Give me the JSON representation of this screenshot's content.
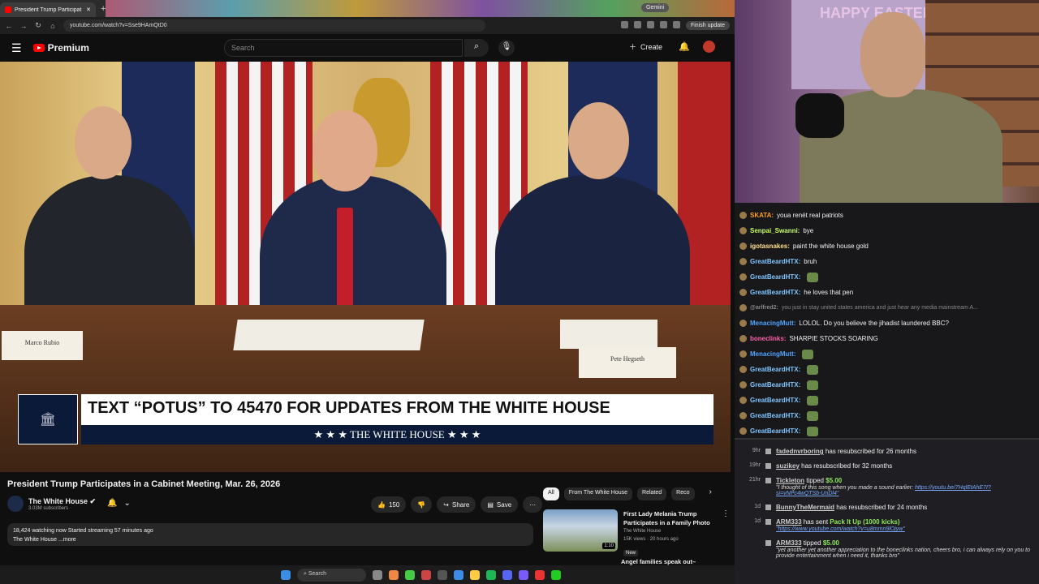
{
  "browser": {
    "tab_title": "President Trump Participat",
    "new_tab": "+",
    "gemini_label": "Gemini",
    "url": "youtube.com/watch?v=Sse9HAmQtD0",
    "finish_update": "Finish update"
  },
  "youtube": {
    "logo": "Premium",
    "search_placeholder": "Search",
    "create_label": "Create"
  },
  "video": {
    "banner_text": "TEXT “POTUS” TO 45470 FOR UPDATES FROM THE WHITE HOUSE",
    "banner_sub": "★ ★ ★  THE WHITE HOUSE  ★ ★ ★",
    "namecard_left": "Marco Rubio",
    "namecard_right": "Pete Hegseth",
    "title": "President Trump Participates in a Cabinet Meeting, Mar. 26, 2026",
    "channel": "The White House",
    "subscribers": "3.03M subscribers",
    "likes": "150",
    "share": "Share",
    "save": "Save",
    "watching": "18,424 watching now  Started streaming 57 minutes ago",
    "desc_more": "The White House ...more"
  },
  "chips": [
    "All",
    "From The White House",
    "Related",
    "Reco"
  ],
  "recommendation": {
    "title": "First Lady Melania Trump Participates in a Family Photo",
    "channel": "The White House",
    "meta": "15K views · 20 hours ago",
    "badge": "New",
    "duration": "1:10",
    "next_title": "Angel families speak out–"
  },
  "taskbar": {
    "search": "Search"
  },
  "webcam": {
    "sign": "HAPPY EASTER"
  },
  "chat": [
    {
      "user": "SKATA:",
      "text": "youa renét real patriots",
      "color": "#ff9f1a"
    },
    {
      "user": "Senpai_Swanni:",
      "text": "bye",
      "color": "#c6ff5e"
    },
    {
      "user": "igotasnakes:",
      "text": "paint the white house gold",
      "color": "#ffe08a"
    },
    {
      "user": "GreatBeardHTX:",
      "text": "bruh",
      "color": "#7fc6ff"
    },
    {
      "user": "GreatBeardHTX:",
      "text": "",
      "color": "#7fc6ff"
    },
    {
      "user": "GreatBeardHTX:",
      "text": "he loves that pen",
      "color": "#7fc6ff"
    },
    {
      "user": "@arlfred2:",
      "text": "you just in stay united states america and just hear any media mainstream A...",
      "color": "#888"
    },
    {
      "user": "MenacingMutt:",
      "text": "LOLOL. Do you believe the jihadist laundered BBC?",
      "color": "#4fa3ff"
    },
    {
      "user": "boneclinks:",
      "text": "SHARPIE STOCKS SOARING",
      "color": "#ff5fa8"
    },
    {
      "user": "MenacingMutt:",
      "text": "",
      "color": "#4fa3ff"
    },
    {
      "user": "GreatBeardHTX:",
      "text": "",
      "color": "#7fc6ff"
    },
    {
      "user": "GreatBeardHTX:",
      "text": "",
      "color": "#7fc6ff"
    },
    {
      "user": "GreatBeardHTX:",
      "text": "",
      "color": "#7fc6ff"
    },
    {
      "user": "GreatBeardHTX:",
      "text": "",
      "color": "#7fc6ff"
    },
    {
      "user": "GreatBeardHTX:",
      "text": "",
      "color": "#7fc6ff"
    }
  ],
  "feed": [
    {
      "time": "9hr",
      "name": "fadednvrboring",
      "text": "has resubscribed for 26 months"
    },
    {
      "time": "19hr",
      "name": "suzikey",
      "text": "has resubscribed for 32 months"
    },
    {
      "time": "21hr",
      "name": "Tickleton",
      "text": "tipped",
      "amount": "$5.00",
      "msg": "\"I thought of this song when you made a sound earlier:",
      "link": "https://youtu.be/7HqlEtAhE7I?si=vNPc4wQTSb-UnDl4\""
    },
    {
      "time": "1d",
      "name": "BunnyTheMermaid",
      "text": "has resubscribed for 24 months"
    },
    {
      "time": "1d",
      "name": "ARM333",
      "text": "has sent",
      "amount": "Pack It Up (1000 kicks)",
      "link": "\"https://www.youtube.com/watch?v=u8mmn9lOjyw\""
    },
    {
      "time": "",
      "name": "ARM333",
      "text": "tipped",
      "amount": "$5.00",
      "msg": "\"yet another yet another appreciation to the boneclinks nation, cheers bro, i can always rely on you to provide entertainment when i need it, thanks bro\""
    }
  ]
}
